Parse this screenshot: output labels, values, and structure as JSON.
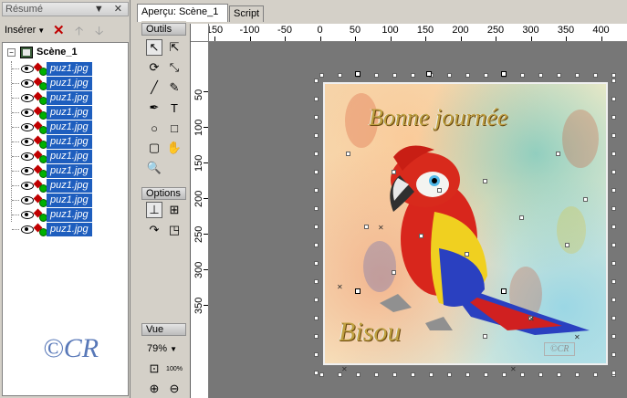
{
  "left_panel": {
    "title": "Résumé",
    "title_buttons": "▼ ✕",
    "toolbar": {
      "insert_label": "Insérer"
    },
    "tree": {
      "root_label": "Scène_1",
      "items": [
        {
          "label": "puz1.jpg"
        },
        {
          "label": "puz1.jpg"
        },
        {
          "label": "puz1.jpg"
        },
        {
          "label": "puz1.jpg"
        },
        {
          "label": "puz1.jpg"
        },
        {
          "label": "puz1.jpg"
        },
        {
          "label": "puz1.jpg"
        },
        {
          "label": "puz1.jpg"
        },
        {
          "label": "puz1.jpg"
        },
        {
          "label": "puz1.jpg"
        },
        {
          "label": "puz1.jpg"
        },
        {
          "label": "puz1.jpg"
        }
      ]
    },
    "signature": "©CR"
  },
  "tabs": [
    {
      "label": "Aperçu: Scène_1",
      "active": true
    },
    {
      "label": "Script",
      "active": false
    }
  ],
  "tool_panel": {
    "outils_header": "Outils",
    "options_header": "Options",
    "vue_header": "Vue",
    "zoom_value": "79%",
    "tools": [
      {
        "icon": "arrow-select-icon",
        "glyph": "↖"
      },
      {
        "icon": "arrow-node-icon",
        "glyph": "⇱"
      },
      {
        "icon": "rotate-icon",
        "glyph": "⟳"
      },
      {
        "icon": "resize-icon",
        "glyph": "⤡"
      },
      {
        "icon": "line-icon",
        "glyph": "╱"
      },
      {
        "icon": "pencil-icon",
        "glyph": "✎"
      },
      {
        "icon": "pen-icon",
        "glyph": "✒"
      },
      {
        "icon": "text-icon",
        "glyph": "T"
      },
      {
        "icon": "ellipse-icon",
        "glyph": "○"
      },
      {
        "icon": "rectangle-icon",
        "glyph": "□"
      },
      {
        "icon": "rounded-rect-icon",
        "glyph": "▢"
      },
      {
        "icon": "hand-icon",
        "glyph": "✋"
      },
      {
        "icon": "zoom-icon",
        "glyph": "🔍"
      }
    ],
    "option_tools": [
      {
        "icon": "snap-grid-icon",
        "glyph": "⊥"
      },
      {
        "icon": "align-icon",
        "glyph": "⊞"
      },
      {
        "icon": "curve-icon",
        "glyph": "↷"
      },
      {
        "icon": "transform-icon",
        "glyph": "◳"
      }
    ],
    "view_tools": [
      {
        "icon": "zoom-fit-icon",
        "glyph": "⊡"
      },
      {
        "icon": "zoom-100-icon",
        "glyph": "100%"
      },
      {
        "icon": "zoom-in-icon",
        "glyph": "⊕"
      },
      {
        "icon": "zoom-out-icon",
        "glyph": "⊖"
      }
    ]
  },
  "canvas": {
    "h_ruler_labels": [
      "150",
      "-100",
      "-50",
      "0",
      "50",
      "100",
      "150",
      "200",
      "250",
      "300",
      "350",
      "400"
    ],
    "v_ruler_labels": [
      "50",
      "100",
      "150",
      "200",
      "250",
      "300",
      "350"
    ],
    "image_title_text": "Bonne journée",
    "image_bottom_text": "Bisou",
    "image_badge_text": "©CR"
  },
  "colors": {
    "selection_blue": "#1e5ebe",
    "panel_gray": "#d4d0c8",
    "canvas_gray": "#777777"
  }
}
